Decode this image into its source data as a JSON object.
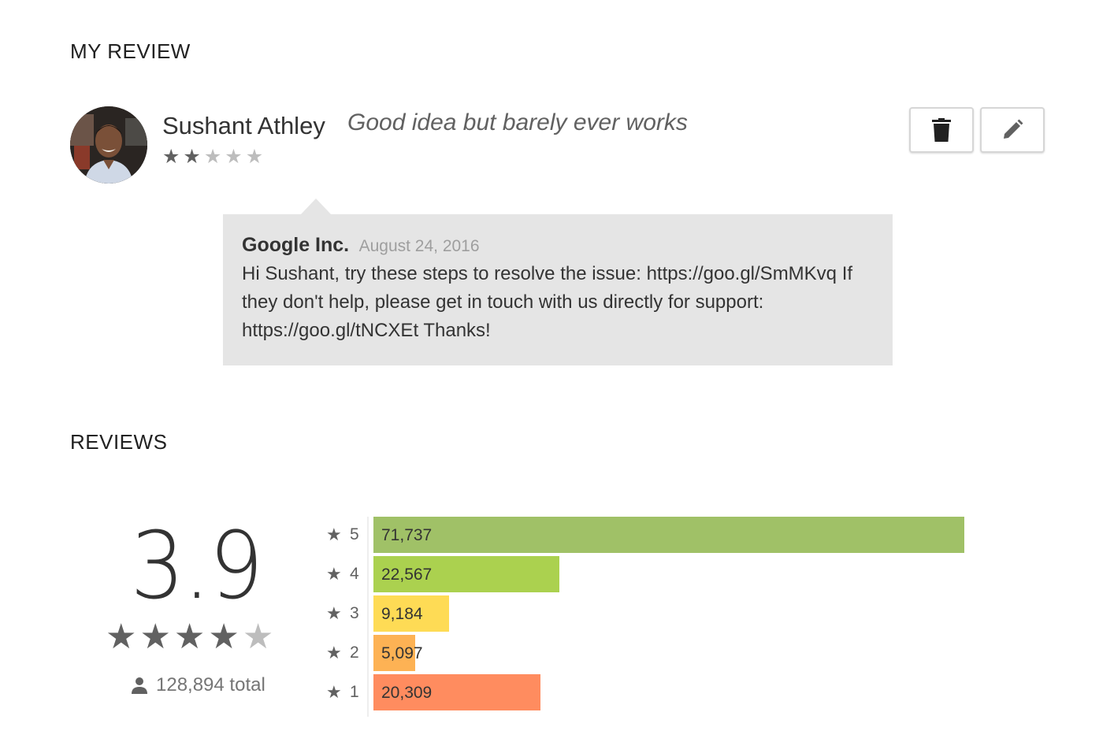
{
  "sections": {
    "my_review": "MY REVIEW",
    "reviews": "REVIEWS"
  },
  "my_review": {
    "reviewer_name": "Sushant Athley",
    "review_title": "Good idea but barely ever works",
    "rating": 2,
    "max_rating": 5,
    "delete_icon": "trash-icon",
    "edit_icon": "pencil-icon"
  },
  "developer_reply": {
    "developer": "Google Inc.",
    "date": "August 24, 2016",
    "text": "Hi Sushant, try these steps to resolve the issue: https://goo.gl/SmMKvq If they don't help, please get in touch with us directly for support: https://goo.gl/tNCXEt Thanks!"
  },
  "summary": {
    "score": "3.9",
    "rating_fraction": 0.78,
    "total_icon": "person-icon",
    "total_label": "128,894 total"
  },
  "histogram": [
    {
      "stars": "5",
      "count_label": "71,737",
      "count": 71737,
      "color": "#a0c167"
    },
    {
      "stars": "4",
      "count_label": "22,567",
      "count": 22567,
      "color": "#abd14f"
    },
    {
      "stars": "3",
      "count_label": "9,184",
      "count": 9184,
      "color": "#fedb55"
    },
    {
      "stars": "2",
      "count_label": "5,097",
      "count": 5097,
      "color": "#fdb254"
    },
    {
      "stars": "1",
      "count_label": "20,309",
      "count": 20309,
      "color": "#ff8c5f"
    }
  ],
  "colors": {
    "star_on": "#616161",
    "star_off": "#bdbdbd",
    "reply_bg": "#e5e5e5"
  }
}
